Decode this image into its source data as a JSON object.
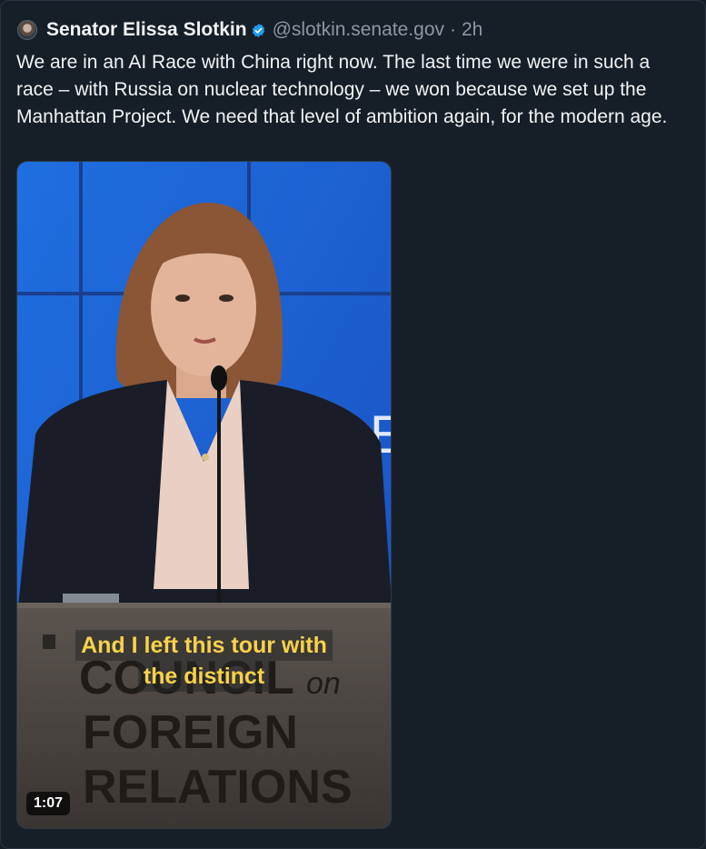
{
  "post": {
    "author": "Senator Elissa Slotkin",
    "handle": "@slotkin.senate.gov",
    "separator": "·",
    "time": "2h",
    "text": "We are in an AI Race with China right now. The last time we were in such a race – with Russia on nuclear technology – we won because we set up the Manhattan Project. We need that level of ambition again, for the modern age.",
    "verified_icon": "verified-badge-icon",
    "avatar_icon": "avatar"
  },
  "video": {
    "caption_line1": "And I left this tour with",
    "caption_line2": "the distinct",
    "duration": "1:07",
    "podium_text": [
      "COUNCIL",
      "on",
      "FOREIGN",
      "RELATIONS"
    ],
    "backdrop_letter": "E"
  },
  "colors": {
    "background": "#161e27",
    "accent_verified": "#1d9bf0",
    "caption_text": "#f7d24a"
  }
}
